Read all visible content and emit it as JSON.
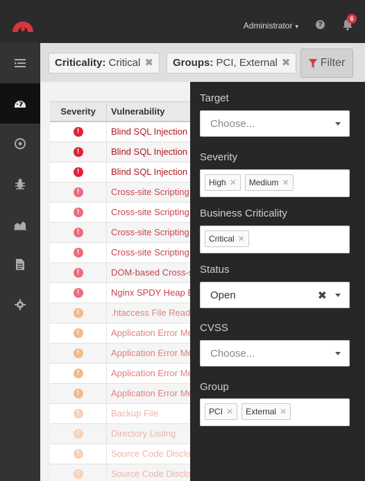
{
  "header": {
    "user_label": "Administrator",
    "notification_count": "6"
  },
  "filters": {
    "chips": [
      {
        "key": "Criticality:",
        "value": "Critical"
      },
      {
        "key": "Groups:",
        "value": "PCI, External"
      }
    ],
    "filter_button_label": "Filter"
  },
  "table": {
    "columns": [
      "Severity",
      "Vulnerability"
    ],
    "rows": [
      {
        "severity": "critical",
        "name": "Blind SQL Injection"
      },
      {
        "severity": "critical",
        "name": "Blind SQL Injection"
      },
      {
        "severity": "critical",
        "name": "Blind SQL Injection"
      },
      {
        "severity": "high",
        "name": "Cross-site Scripting"
      },
      {
        "severity": "high",
        "name": "Cross-site Scripting"
      },
      {
        "severity": "high",
        "name": "Cross-site Scripting"
      },
      {
        "severity": "high",
        "name": "Cross-site Scripting"
      },
      {
        "severity": "high",
        "name": "DOM-based Cross-site Scripting"
      },
      {
        "severity": "high",
        "name": "Nginx SPDY Heap Buffer Overflow"
      },
      {
        "severity": "medium",
        "name": ".htaccess File Readable"
      },
      {
        "severity": "medium",
        "name": "Application Error Message"
      },
      {
        "severity": "medium",
        "name": "Application Error Message"
      },
      {
        "severity": "medium",
        "name": "Application Error Message"
      },
      {
        "severity": "medium",
        "name": "Application Error Message"
      },
      {
        "severity": "low",
        "name": "Backup File"
      },
      {
        "severity": "low",
        "name": "Directory Listing"
      },
      {
        "severity": "low",
        "name": "Source Code Disclosure"
      },
      {
        "severity": "low",
        "name": "Source Code Disclosure"
      }
    ]
  },
  "panel": {
    "target_label": "Target",
    "target_placeholder": "Choose...",
    "severity_label": "Severity",
    "severity_tags": [
      "High",
      "Medium"
    ],
    "criticality_label": "Business Criticality",
    "criticality_tags": [
      "Critical"
    ],
    "status_label": "Status",
    "status_value": "Open",
    "cvss_label": "CVSS",
    "cvss_placeholder": "Choose...",
    "group_label": "Group",
    "group_tags": [
      "PCI",
      "External"
    ]
  },
  "colors": {
    "brand": "#d9363e",
    "critical": "#e0213a",
    "high": "#ec6b7e",
    "medium": "#f2b98a",
    "low": "#f6d2bb",
    "critical_text": "#b3131f",
    "high_text": "#c8424f",
    "medium_text": "#e07f80",
    "low_text": "#eeb3ae"
  },
  "icons": {
    "sidebar": [
      "list-icon",
      "dashboard-icon",
      "target-icon",
      "bug-icon",
      "chart-icon",
      "document-icon",
      "settings-icon"
    ]
  }
}
